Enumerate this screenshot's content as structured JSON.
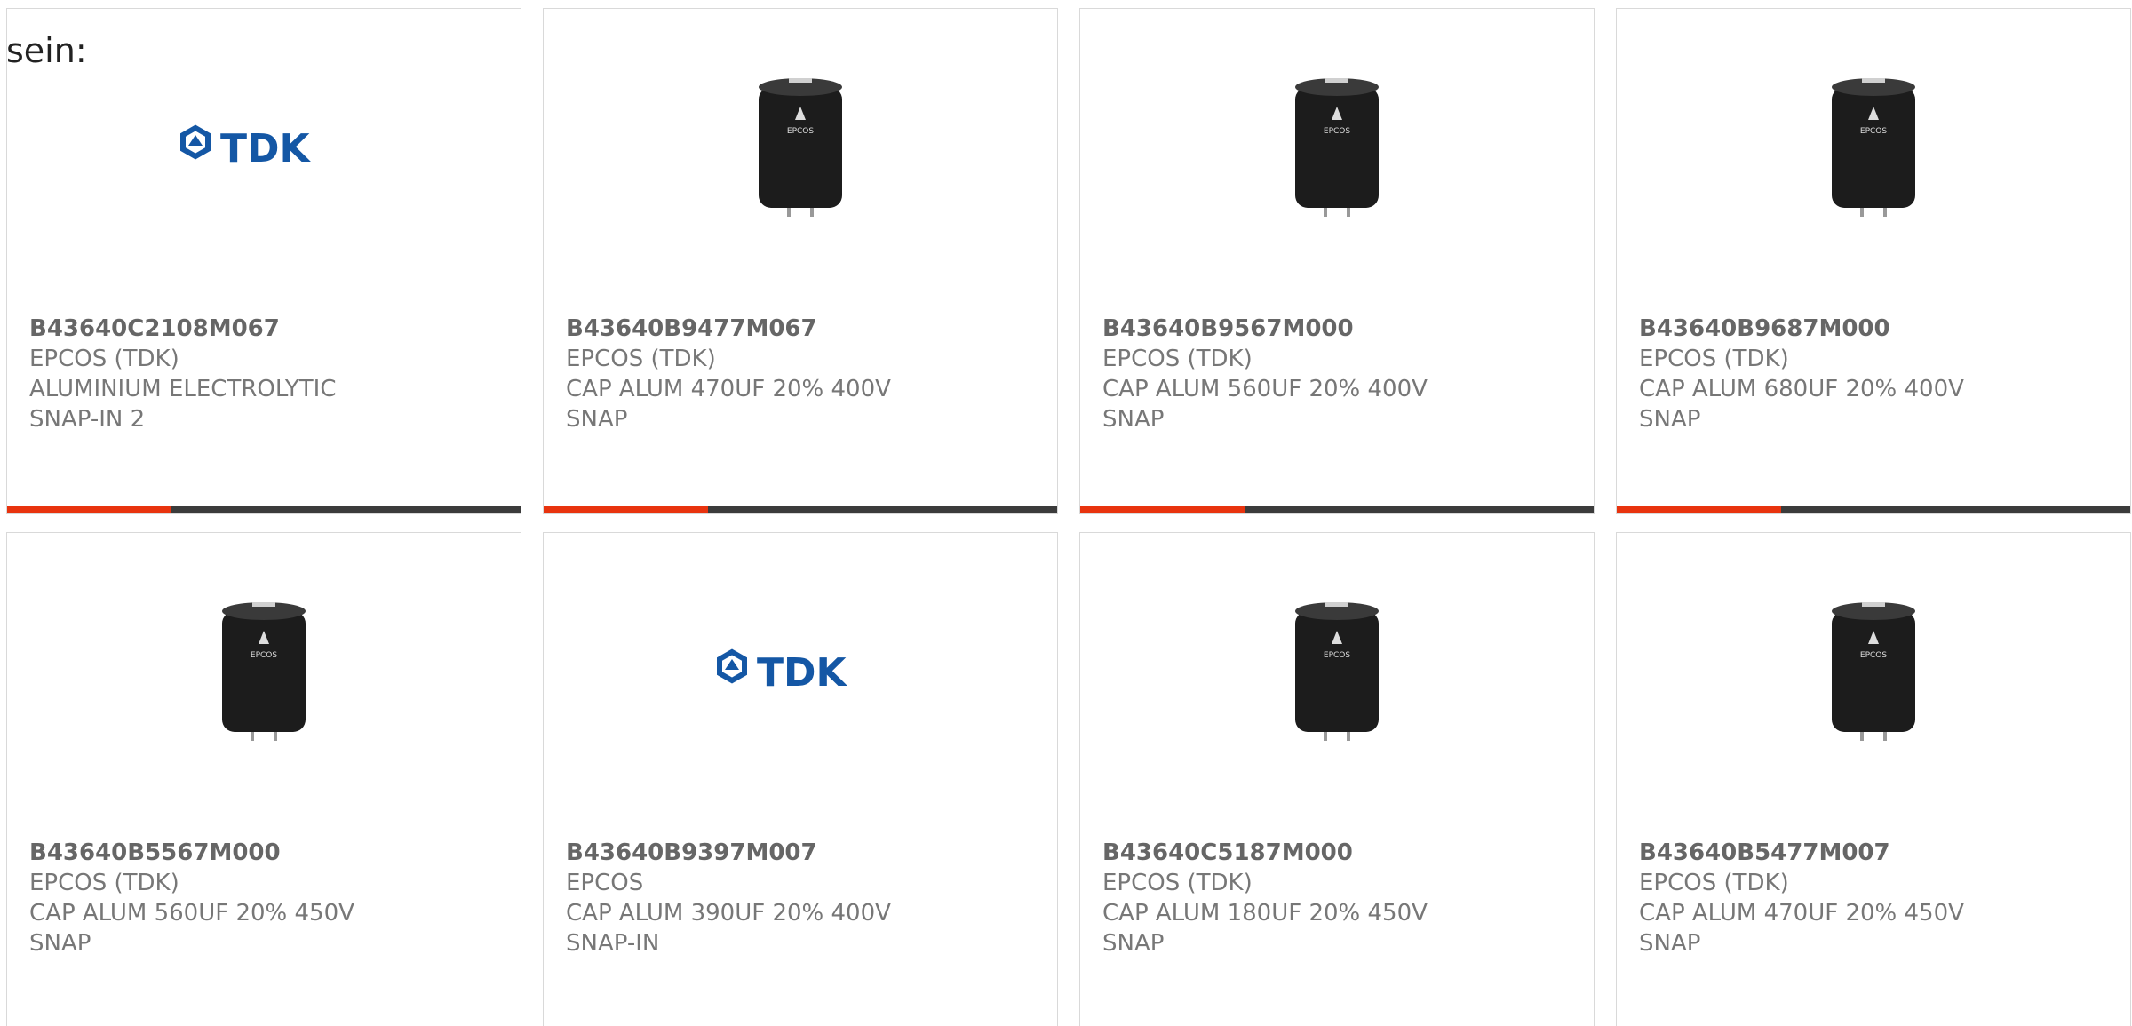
{
  "intro_text": "sein:",
  "colors": {
    "accent": "#e8330e",
    "bar_dark": "#3b3b3b",
    "tdk_blue": "#1457a5",
    "text_gray": "#777777"
  },
  "logo_text": "TDK",
  "capacitor_label": "EPCOS",
  "progress_fraction": 0.32,
  "products": [
    {
      "part_number": "B43640C2108M067",
      "manufacturer": "EPCOS (TDK)",
      "desc_line1": "ALUMINIUM ELECTROLYTIC",
      "desc_line2": "SNAP-IN 2",
      "image": "tdk-logo"
    },
    {
      "part_number": "B43640B9477M067",
      "manufacturer": "EPCOS (TDK)",
      "desc_line1": "CAP ALUM 470UF 20% 400V",
      "desc_line2": "SNAP",
      "image": "capacitor"
    },
    {
      "part_number": "B43640B9567M000",
      "manufacturer": "EPCOS (TDK)",
      "desc_line1": "CAP ALUM 560UF 20% 400V",
      "desc_line2": "SNAP",
      "image": "capacitor"
    },
    {
      "part_number": "B43640B9687M000",
      "manufacturer": "EPCOS (TDK)",
      "desc_line1": "CAP ALUM 680UF 20% 400V",
      "desc_line2": "SNAP",
      "image": "capacitor"
    },
    {
      "part_number": "B43640B5567M000",
      "manufacturer": "EPCOS (TDK)",
      "desc_line1": "CAP ALUM 560UF 20% 450V",
      "desc_line2": "SNAP",
      "image": "capacitor"
    },
    {
      "part_number": "B43640B9397M007",
      "manufacturer": "EPCOS",
      "desc_line1": "CAP ALUM 390UF 20% 400V",
      "desc_line2": "SNAP-IN",
      "image": "tdk-logo"
    },
    {
      "part_number": "B43640C5187M000",
      "manufacturer": "EPCOS (TDK)",
      "desc_line1": "CAP ALUM 180UF 20% 450V",
      "desc_line2": "SNAP",
      "image": "capacitor"
    },
    {
      "part_number": "B43640B5477M007",
      "manufacturer": "EPCOS (TDK)",
      "desc_line1": "CAP ALUM 470UF 20% 450V",
      "desc_line2": "SNAP",
      "image": "capacitor"
    }
  ]
}
